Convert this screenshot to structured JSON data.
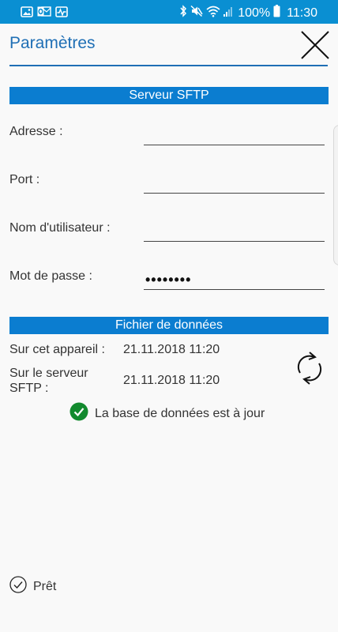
{
  "status_bar": {
    "battery": "100%",
    "time": "11:30",
    "background_color": "#0a8fd2",
    "left_icons": [
      "image-icon",
      "outlook-icon",
      "activity-icon"
    ],
    "right_icons": [
      "bluetooth-icon",
      "mute-icon",
      "wifi-icon",
      "signal-icon",
      "battery-icon"
    ]
  },
  "header": {
    "title": "Paramètres",
    "accent_color": "#1f6fb5",
    "close_icon": "close-icon"
  },
  "sftp_section": {
    "title": "Serveur SFTP",
    "bar_color": "#0b7dd0",
    "fields": [
      {
        "label": "Adresse :",
        "value": "",
        "type": "text"
      },
      {
        "label": "Port :",
        "value": "",
        "type": "text"
      },
      {
        "label": "Nom d'utilisateur :",
        "value": "",
        "type": "text"
      },
      {
        "label": "Mot de passe :",
        "value": "••••••••",
        "type": "password"
      }
    ]
  },
  "data_section": {
    "title": "Fichier de données",
    "device_label": "Sur cet appareil :",
    "device_date": "21.11.2018 11:20",
    "server_label_line1": "Sur le serveur",
    "server_label_line2": "SFTP :",
    "server_date": "21.11.2018 11:20",
    "sync_icon": "sync-icon",
    "status_message": "La base de données est à jour",
    "status_color": "#128a2e"
  },
  "footer": {
    "status": "Prêt",
    "status_icon": "check-circle-icon"
  }
}
